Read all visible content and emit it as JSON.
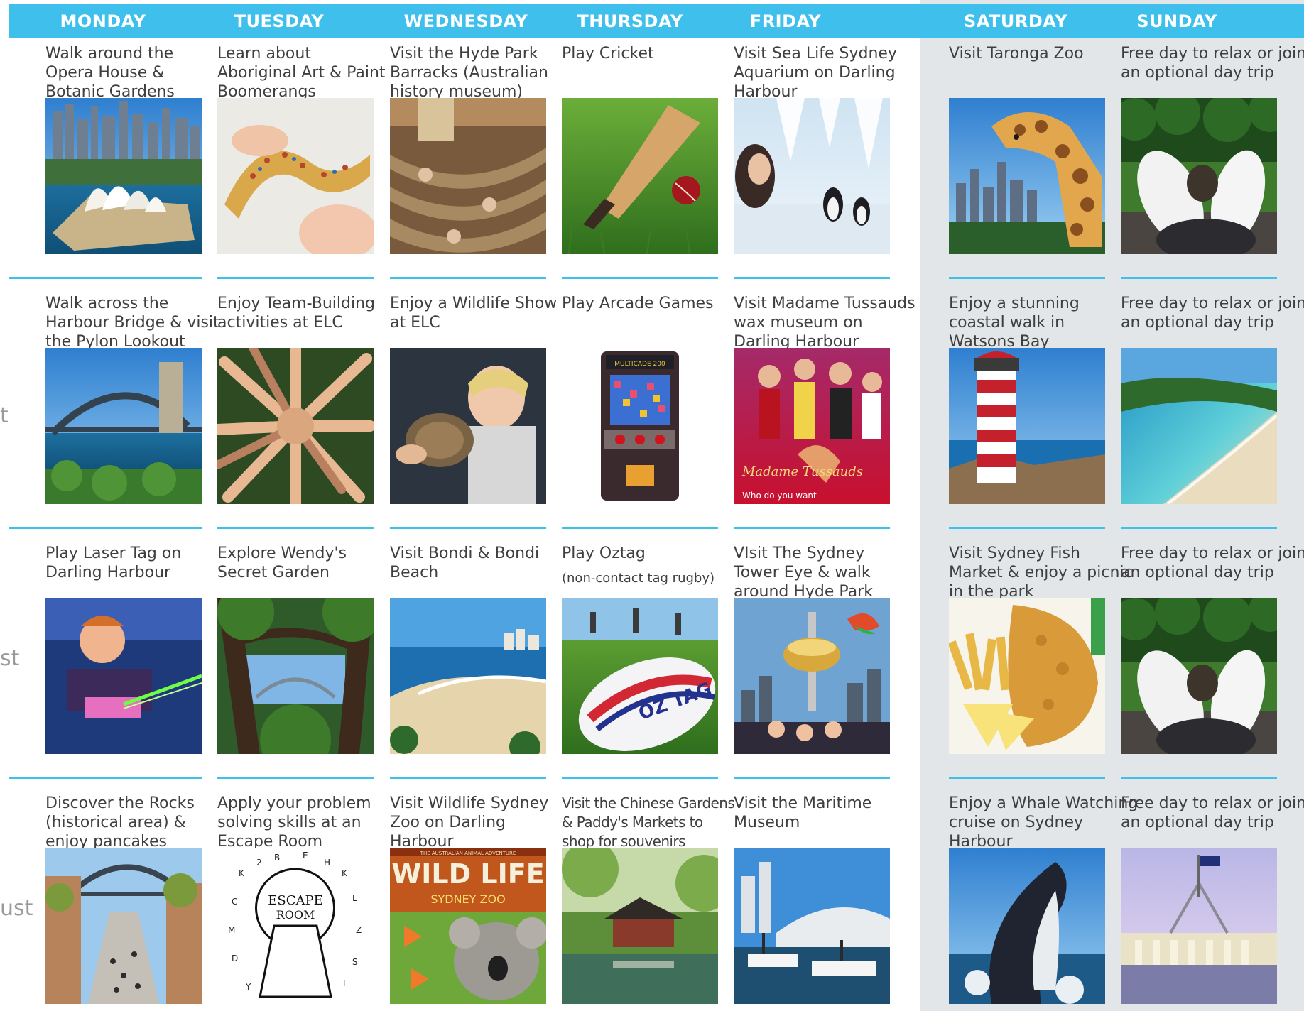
{
  "days": [
    "MONDAY",
    "TUESDAY",
    "WEDNESDAY",
    "THURSDAY",
    "FRIDAY",
    "SATURDAY",
    "SUNDAY"
  ],
  "side_fragments": [
    "t",
    "st",
    "ust"
  ],
  "weeks": [
    [
      {
        "lines": [
          "Walk around the",
          "Opera House &",
          "Botanic Gardens"
        ],
        "image": "opera-house-photo"
      },
      {
        "lines": [
          "Learn about",
          "Aboriginal Art & Paint",
          "Boomerangs"
        ],
        "image": "boomerang-painting-photo"
      },
      {
        "lines": [
          "Visit the Hyde Park",
          "Barracks (Australian",
          "history museum)"
        ],
        "image": "hammocks-museum-photo"
      },
      {
        "lines": [
          "Play Cricket"
        ],
        "image": "cricket-bat-ball-photo"
      },
      {
        "lines": [
          "Visit Sea Life Sydney",
          "Aquarium on Darling",
          "Harbour"
        ],
        "image": "penguins-aquarium-photo"
      },
      {
        "lines": [
          "Visit Taronga Zoo"
        ],
        "image": "giraffe-city-photo"
      },
      {
        "lines": [
          "Free day to relax or join",
          "an optional day trip"
        ],
        "image": "relax-feet-dog-photo"
      }
    ],
    [
      {
        "lines": [
          "Walk across the",
          "Harbour Bridge & visit",
          "the Pylon Lookout"
        ],
        "image": "harbour-bridge-photo"
      },
      {
        "lines": [
          "Enjoy Team-Building",
          "activities at ELC"
        ],
        "image": "team-hands-photo"
      },
      {
        "lines": [
          "Enjoy a Wildlife Show",
          "at ELC"
        ],
        "image": "wildlife-show-photo"
      },
      {
        "lines": [
          "Play Arcade Games"
        ],
        "image": "arcade-machine-photo"
      },
      {
        "lines": [
          "Visit Madame Tussauds",
          "wax museum on",
          "Darling Harbour"
        ],
        "image": "madame-tussauds-poster"
      },
      {
        "lines": [
          "Enjoy a stunning",
          "coastal walk in",
          "Watsons Bay"
        ],
        "image": "lighthouse-photo"
      },
      {
        "lines": [
          "Free day to relax or join",
          "an optional day trip"
        ],
        "image": "beach-aerial-photo"
      }
    ],
    [
      {
        "lines": [
          "Play Laser Tag on",
          "Darling Harbour"
        ],
        "image": "laser-tag-photo"
      },
      {
        "lines": [
          "Explore Wendy's",
          "Secret Garden"
        ],
        "image": "secret-garden-photo"
      },
      {
        "lines": [
          "Visit Bondi & Bondi",
          "Beach"
        ],
        "image": "bondi-beach-photo"
      },
      {
        "lines": [
          "Play Oztag"
        ],
        "sub": "(non-contact tag rugby)",
        "image": "oztag-ball-photo"
      },
      {
        "lines": [
          "VIsit The Sydney",
          "Tower Eye & walk",
          "around Hyde Park"
        ],
        "image": "sydney-tower-photo"
      },
      {
        "lines": [
          "Visit Sydney Fish",
          "Market & enjoy a picnic",
          "in the park"
        ],
        "image": "fish-chips-photo"
      },
      {
        "lines": [
          "Free day to relax or join",
          "an optional day trip"
        ],
        "image": "relax-feet-dog-photo"
      }
    ],
    [
      {
        "lines": [
          "Discover the Rocks",
          "(historical area) &",
          "enjoy pancakes"
        ],
        "image": "the-rocks-photo"
      },
      {
        "lines": [
          "Apply your problem",
          "solving skills at an",
          "Escape Room"
        ],
        "image": "escape-room-graphic"
      },
      {
        "lines": [
          "Visit Wildlife Sydney",
          "Zoo on Darling",
          "Harbour"
        ],
        "image": "wildlife-zoo-poster",
        "poster": {
          "top": "THE AUSTRALIAN ANIMAL ADVENTURE",
          "big": "WILD LIFE",
          "small": "SYDNEY ZOO"
        }
      },
      {
        "lines": [
          "Visit the Chinese Gardens",
          "& Paddy's Markets to",
          "shop for souvenirs"
        ],
        "image": "chinese-garden-photo"
      },
      {
        "lines": [
          "Visit the Maritime",
          "Museum"
        ],
        "image": "maritime-museum-photo"
      },
      {
        "lines": [
          "Enjoy a Whale Watching",
          "cruise on Sydney",
          "Harbour"
        ],
        "image": "whale-photo"
      },
      {
        "lines": [
          "Free day to relax or join",
          "an optional day trip"
        ],
        "image": "parliament-house-photo"
      }
    ]
  ],
  "image_texts": {
    "tussauds_logo": "Madame Tussauds",
    "tussauds_tag": "Who do you want",
    "oztag_logo": "OZ TAG",
    "escape_room": [
      "ESCAPE",
      "ROOM"
    ],
    "arcade_title": "MULTICADE 200"
  },
  "colors": {
    "accent": "#3fc0ec",
    "weekend_bg": "#e3e6e8",
    "text": "#3f3f3f"
  }
}
